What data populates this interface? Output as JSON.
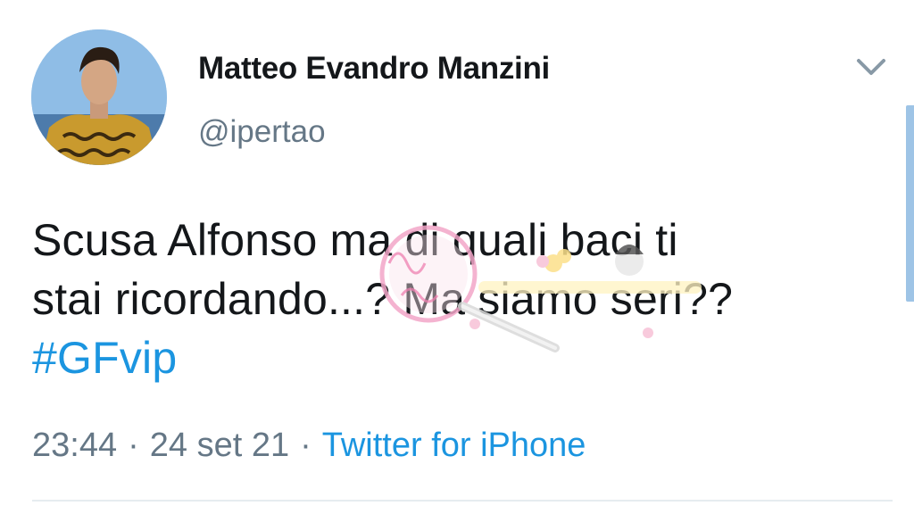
{
  "user": {
    "display_name": "Matteo Evandro Manzini",
    "handle": "@ipertao"
  },
  "tweet": {
    "line1": "Scusa Alfonso ma di quali baci ti",
    "line2": "stai ricordando...? Ma siamo seri??",
    "hashtag": "#GFvip"
  },
  "meta": {
    "time": "23:44",
    "date": "24 set 21",
    "separator": "·",
    "source": "Twitter for iPhone"
  },
  "icons": {
    "menu": "chevron-down-icon"
  },
  "colors": {
    "link": "#1b95e0",
    "secondary_text": "#657786",
    "primary_text": "#14171a"
  }
}
